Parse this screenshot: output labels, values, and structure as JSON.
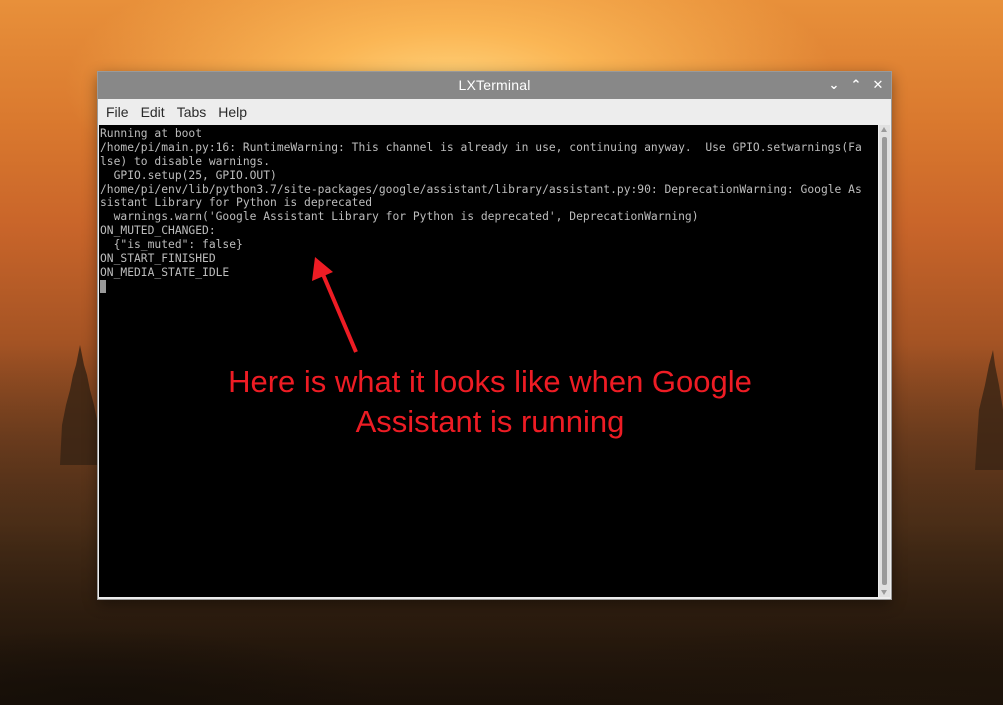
{
  "window": {
    "title": "LXTerminal",
    "controls": {
      "minimize": "⌄",
      "maximize": "⌃",
      "close": "✕"
    }
  },
  "menu": {
    "items": [
      "File",
      "Edit",
      "Tabs",
      "Help"
    ]
  },
  "terminal": {
    "lines": [
      "Running at boot",
      "/home/pi/main.py:16: RuntimeWarning: This channel is already in use, continuing anyway.  Use GPIO.setwarnings(Fa",
      "lse) to disable warnings.",
      "  GPIO.setup(25, GPIO.OUT)",
      "/home/pi/env/lib/python3.7/site-packages/google/assistant/library/assistant.py:90: DeprecationWarning: Google As",
      "sistant Library for Python is deprecated",
      "  warnings.warn('Google Assistant Library for Python is deprecated', DeprecationWarning)",
      "ON_MUTED_CHANGED:",
      "  {\"is_muted\": false}",
      "ON_START_FINISHED",
      "ON_MEDIA_STATE_IDLE"
    ],
    "text_color": "#bdbdbd",
    "background": "#000000"
  },
  "annotation": {
    "line1": "Here is what it looks like when Google",
    "line2": "Assistant is running",
    "color": "#ee1c24"
  }
}
